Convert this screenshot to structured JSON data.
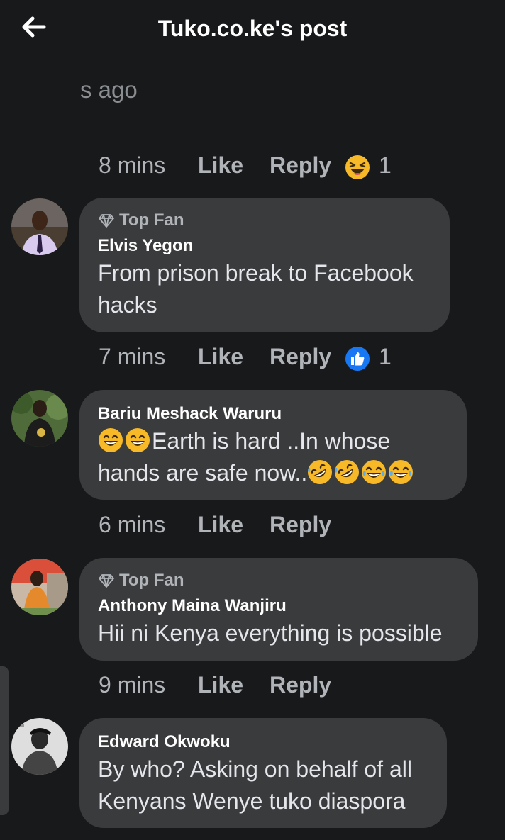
{
  "header": {
    "title": "Tuko.co.ke's post"
  },
  "partial_text": "s ago",
  "comments": [
    {
      "time": "8 mins",
      "like": "Like",
      "reply": "Reply",
      "reaction_icon": "laughing-reaction-icon",
      "reaction_count": "1"
    },
    {
      "top_fan": "Top Fan",
      "author": "Elvis Yegon",
      "text_lines": [
        "From prison break to Facebook",
        "hacks"
      ],
      "time": "7 mins",
      "like": "Like",
      "reply": "Reply",
      "reaction_icon": "like-reaction-icon",
      "reaction_count": "1"
    },
    {
      "author": "Bariu Meshack Waruru",
      "text_lines": [
        "Earth is hard ..In whose",
        "hands are safe now.."
      ],
      "time": "6 mins",
      "like": "Like",
      "reply": "Reply"
    },
    {
      "top_fan": "Top Fan",
      "author": "Anthony Maina Wanjiru",
      "text_lines": [
        "Hii ni Kenya everything is possible"
      ],
      "time": "9 mins",
      "like": "Like",
      "reply": "Reply"
    },
    {
      "author": "Edward Okwoku",
      "text_lines": [
        "By who? Asking on behalf of all",
        "Kenyans Wenye tuko diaspora"
      ]
    }
  ],
  "colors": {
    "background": "#18191a",
    "bubble": "#3a3b3c",
    "meta": "#b0b3b8",
    "like_blue": "#1877f2",
    "emoji_yellow": "#f7b928"
  }
}
